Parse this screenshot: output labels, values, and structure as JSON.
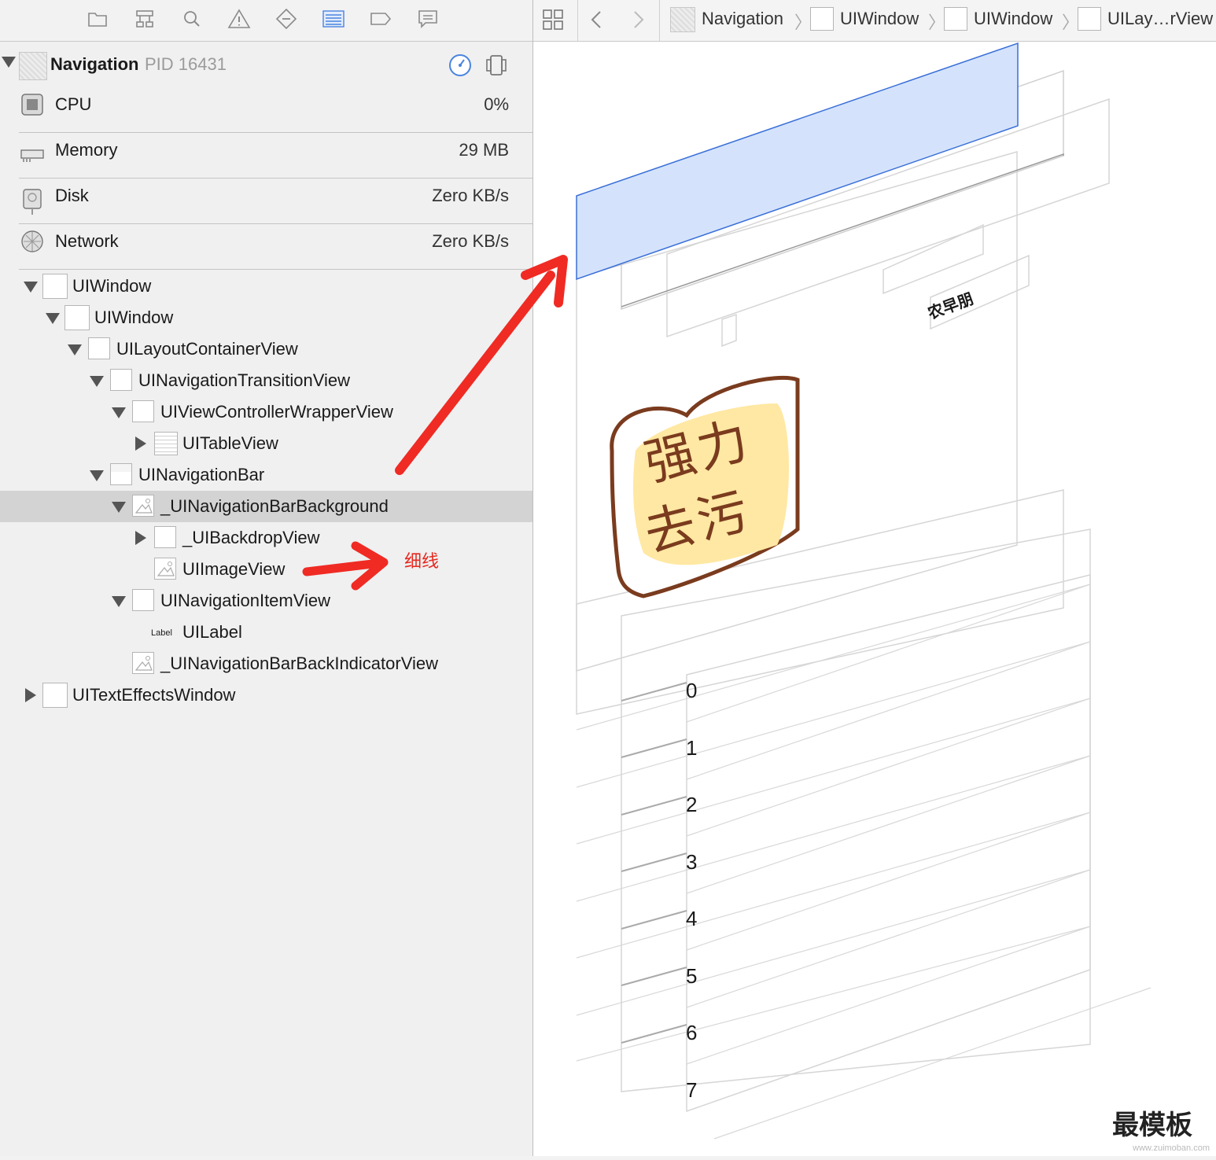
{
  "process": {
    "name": "Navigation",
    "pid": "PID 16431"
  },
  "metrics": [
    {
      "label": "CPU",
      "value": "0%",
      "icon": "cpu-icon"
    },
    {
      "label": "Memory",
      "value": "29 MB",
      "icon": "memory-icon"
    },
    {
      "label": "Disk",
      "value": "Zero KB/s",
      "icon": "disk-icon"
    },
    {
      "label": "Network",
      "value": "Zero KB/s",
      "icon": "network-icon"
    }
  ],
  "tree": [
    "UIWindow",
    "UIWindow",
    "UILayoutContainerView",
    "UINavigationTransitionView",
    "UIViewControllerWrapperView",
    "UITableView",
    "UINavigationBar",
    "_UINavigationBarBackground",
    "_UIBackdropView",
    "UIImageView",
    "UINavigationItemView",
    "UILabel",
    "_UINavigationBarBackIndicatorView",
    "UITextEffectsWindow"
  ],
  "label_badge": "Label",
  "breadcrumb": [
    "Navigation",
    "UIWindow",
    "UIWindow",
    "UILay…rView"
  ],
  "annotation": "细线",
  "canvas": {
    "nav_title": "农早朋",
    "sticker": [
      "强力",
      "去污"
    ],
    "rows": [
      "0",
      "1",
      "2",
      "3",
      "4",
      "5",
      "6",
      "7"
    ]
  },
  "watermark": "最模板",
  "watermark_url": "www.zuimoban.com",
  "colors": {
    "selection": "#d3d3d3",
    "highlight_fill": "#d4e3fb",
    "highlight_stroke": "#3a6fd8",
    "arrow": "#ef2b24",
    "annotation": "#e5281f"
  }
}
